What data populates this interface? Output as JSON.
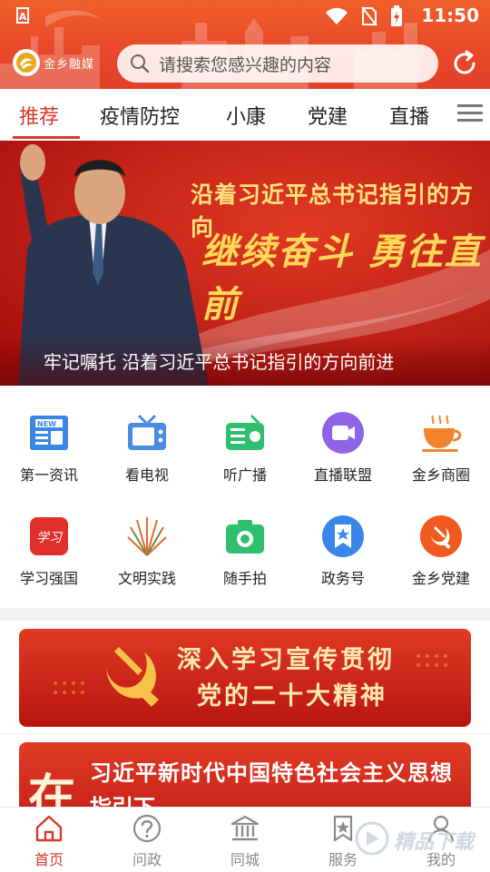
{
  "status_bar": {
    "carrier_icon": "A",
    "time": "11:50"
  },
  "header": {
    "logo_text": "金乡融媒",
    "search_placeholder": "请搜索您感兴趣的内容"
  },
  "tabs": [
    {
      "label": "推荐",
      "active": true
    },
    {
      "label": "疫情防控",
      "active": false
    },
    {
      "label": "小康",
      "active": false
    },
    {
      "label": "党建",
      "active": false
    },
    {
      "label": "直播",
      "active": false
    }
  ],
  "banner": {
    "headline": "沿着习近平总书记指引的方向",
    "slogan": "继续奋斗 勇往直前",
    "caption": "牢记嘱托 沿着习近平总书记指引的方向前进"
  },
  "grid": [
    {
      "label": "第一资讯",
      "icon": "newspaper-icon",
      "color": "#3a86e8"
    },
    {
      "label": "看电视",
      "icon": "tv-icon",
      "color": "#4a8be6"
    },
    {
      "label": "听广播",
      "icon": "radio-icon",
      "color": "#2fbf6e"
    },
    {
      "label": "直播联盟",
      "icon": "video-camera-icon",
      "color": "#8e63e8"
    },
    {
      "label": "金乡商圈",
      "icon": "coffee-cup-icon",
      "color": "#f3832a"
    },
    {
      "label": "学习强国",
      "icon": "xuexi-icon",
      "color": "#e0302b"
    },
    {
      "label": "文明实践",
      "icon": "fan-icon",
      "color": "#e56a2a"
    },
    {
      "label": "随手拍",
      "icon": "camera-icon",
      "color": "#2fbf6e"
    },
    {
      "label": "政务号",
      "icon": "bookmark-star-icon",
      "color": "#3a86e8"
    },
    {
      "label": "金乡党建",
      "icon": "party-emblem-icon",
      "color": "#f05a1f"
    }
  ],
  "cards": {
    "party_line1": "深入学习宣传贯彻",
    "party_line2": "党的二十大精神",
    "thought_line1": "习近平新时代中国特色社会主义思想",
    "thought_line2": "指引下",
    "thought_big": "在"
  },
  "bottom_nav": [
    {
      "label": "首页",
      "icon": "home-icon",
      "active": true
    },
    {
      "label": "问政",
      "icon": "question-icon",
      "active": false
    },
    {
      "label": "同城",
      "icon": "bank-icon",
      "active": false
    },
    {
      "label": "服务",
      "icon": "service-icon",
      "active": false
    },
    {
      "label": "我的",
      "icon": "user-icon",
      "active": false
    }
  ],
  "watermark": "精品下载",
  "colors": {
    "brand_red": "#d23b2b",
    "header_orange": "#e8472a"
  }
}
